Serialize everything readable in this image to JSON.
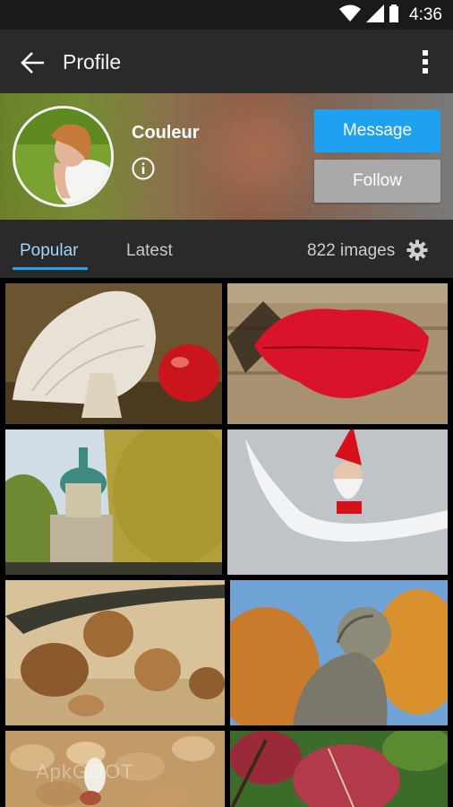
{
  "status_bar": {
    "time": "4:36",
    "icons": [
      "wifi-icon",
      "signal-icon",
      "battery-icon"
    ]
  },
  "app_bar": {
    "title": "Profile",
    "back_icon": "arrow-left-icon",
    "menu_icon": "more-vert-icon"
  },
  "profile": {
    "name": "Couleur",
    "info_icon": "info-icon",
    "message_label": "Message",
    "follow_label": "Follow"
  },
  "tabs": {
    "items": [
      {
        "label": "Popular",
        "active": true
      },
      {
        "label": "Latest",
        "active": false
      }
    ],
    "image_count": "822 images",
    "settings_icon": "gear-icon"
  },
  "colors": {
    "accent": "#1ea1f1",
    "app_bar": "#2a2a2a",
    "follow_button": "#a9a9a9"
  },
  "grid": {
    "images": [
      {
        "subject": "mushroom"
      },
      {
        "subject": "red leaf on wood"
      },
      {
        "subject": "domed building"
      },
      {
        "subject": "gnome on snowy branch"
      },
      {
        "subject": "walnuts and nutcracker"
      },
      {
        "subject": "stone statue"
      },
      {
        "subject": "peanuts"
      },
      {
        "subject": "autumn vine leaves"
      }
    ]
  },
  "watermark": "ApkGOOT"
}
